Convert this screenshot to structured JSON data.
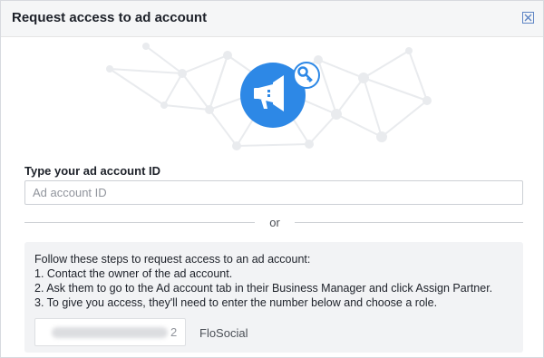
{
  "dialog": {
    "title": "Request access to ad account",
    "close_icon": "close-icon"
  },
  "hero": {
    "icon": "megaphone-icon",
    "badge_icon": "key-icon",
    "accent_color": "#2d88e6"
  },
  "form": {
    "label": "Type your ad account ID",
    "placeholder": "Ad account ID",
    "value": ""
  },
  "divider": {
    "text": "or"
  },
  "steps": {
    "intro": "Follow these steps to request access to an ad account:",
    "items": [
      "1. Contact the owner of the ad account.",
      "2. Ask them to go to the Ad account tab in their Business Manager and click Assign Partner.",
      "3. To give you access, they'll need to enter the number below and choose a role."
    ],
    "code_tail": "2",
    "business_name": "FloSocial"
  }
}
